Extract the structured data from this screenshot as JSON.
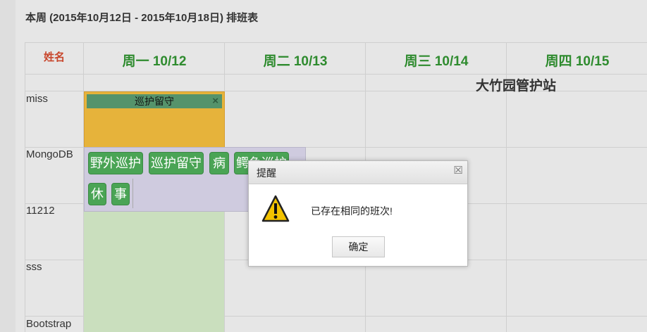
{
  "page": {
    "title": "本周 (2015年10月12日 - 2015年10月18日) 排班表"
  },
  "schedule": {
    "name_header": "姓名",
    "days": [
      "周一 10/12",
      "周二 10/13",
      "周三 10/14",
      "周四 10/15"
    ],
    "station": "大竹园管护站",
    "rows": [
      "miss",
      "MongoDB",
      "11212",
      "sss",
      "Bootstrap"
    ],
    "assigned_shift": {
      "label": "巡护留守",
      "close": "×"
    }
  },
  "shift_picker": {
    "options": [
      "野外巡护",
      "巡护留守",
      "病",
      "鳄鱼巡护",
      "休",
      "事"
    ]
  },
  "dialog": {
    "title": "提醒",
    "message": "已存在相同的班次!",
    "ok_label": "确定",
    "close": "☒"
  },
  "colors": {
    "day_header": "#2e8b2e",
    "name_header": "#c8462c",
    "assigned_cell": "#e6b33b",
    "shift_bar": "#55936b",
    "tag": "#4aa455",
    "picker_bg": "#cfcbdf",
    "green_column": "#cadfbe"
  },
  "icons": {
    "warning": "warning-icon"
  }
}
